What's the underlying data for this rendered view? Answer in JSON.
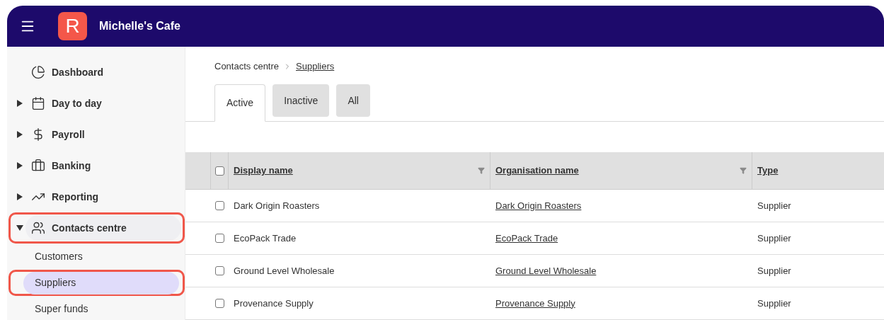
{
  "header": {
    "org_name": "Michelle's Cafe",
    "logo_letter": "R"
  },
  "sidebar": {
    "items": [
      {
        "label": "Dashboard",
        "kind": "link",
        "highlighted": false
      },
      {
        "label": "Day to day",
        "kind": "group",
        "expanded": false,
        "highlighted": false
      },
      {
        "label": "Payroll",
        "kind": "group",
        "expanded": false,
        "highlighted": false
      },
      {
        "label": "Banking",
        "kind": "group",
        "expanded": false,
        "highlighted": false
      },
      {
        "label": "Reporting",
        "kind": "group",
        "expanded": false,
        "highlighted": false
      },
      {
        "label": "Contacts centre",
        "kind": "group",
        "expanded": true,
        "highlighted": true,
        "children": [
          {
            "label": "Customers",
            "selected": false,
            "highlighted": false
          },
          {
            "label": "Suppliers",
            "selected": true,
            "highlighted": true
          },
          {
            "label": "Super funds",
            "selected": false,
            "highlighted": false
          }
        ]
      }
    ]
  },
  "breadcrumb": [
    "Contacts centre",
    "Suppliers"
  ],
  "tabs": [
    {
      "label": "Active",
      "selected": true
    },
    {
      "label": "Inactive",
      "selected": false
    },
    {
      "label": "All",
      "selected": false
    }
  ],
  "table": {
    "select_all_checked": false,
    "columns": [
      {
        "label": "Display name",
        "filter": true
      },
      {
        "label": "Organisation name",
        "filter": true
      },
      {
        "label": "Type",
        "filter": false
      }
    ],
    "rows": [
      {
        "checked": false,
        "display_name": "Dark Origin Roasters",
        "organisation_name": "Dark Origin Roasters",
        "type": "Supplier"
      },
      {
        "checked": false,
        "display_name": "EcoPack Trade",
        "organisation_name": "EcoPack Trade",
        "type": "Supplier"
      },
      {
        "checked": false,
        "display_name": "Ground Level Wholesale",
        "organisation_name": "Ground Level Wholesale",
        "type": "Supplier"
      },
      {
        "checked": false,
        "display_name": "Provenance Supply",
        "organisation_name": "Provenance Supply",
        "type": "Supplier"
      }
    ]
  }
}
